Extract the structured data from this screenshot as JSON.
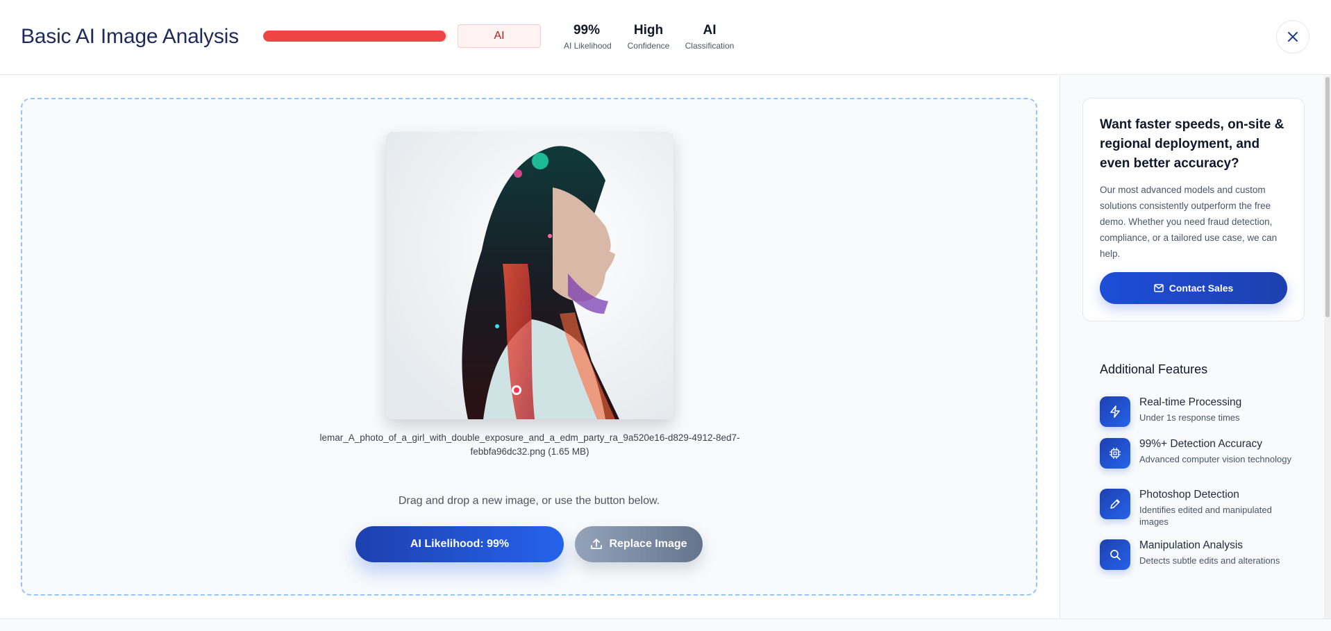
{
  "header": {
    "title": "Basic AI Image Analysis",
    "likelihood_fraction": 0.99,
    "bar_color": "#ef4444",
    "badge_label": "AI",
    "stats": [
      {
        "value": "99%",
        "label": "AI Likelihood"
      },
      {
        "value": "High",
        "label": "Confidence"
      },
      {
        "value": "AI",
        "label": "Classification"
      }
    ]
  },
  "main": {
    "filename": "lemar_A_photo_of_a_girl_with_double_exposure_and_a_edm_party_ra_9a520e16-d829-4912-8ed7-febbfa96dc32.png (1.65 MB)",
    "hint": "Drag and drop a new image, or use the button below.",
    "primary_button": "AI Likelihood: 99%",
    "replace_button": "Replace Image"
  },
  "sidebar": {
    "promo_title": "Want faster speeds, on-site & regional deployment, and even better accuracy?",
    "promo_text": "Our most advanced models and custom solutions consistently outperform the free demo. Whether you need fraud detection, compliance, or a tailored use case, we can help.",
    "contact_button": "Contact Sales",
    "features_title": "Additional Features",
    "features": [
      {
        "title": "Real-time Processing",
        "desc": "Under 1s response times",
        "icon": "lightning-icon"
      },
      {
        "title": "99%+ Detection Accuracy",
        "desc": "Advanced computer vision technology",
        "icon": "chip-icon"
      },
      {
        "title": "Photoshop Detection",
        "desc": "Identifies edited and manipulated images",
        "icon": "pencil-icon"
      },
      {
        "title": "Manipulation Analysis",
        "desc": "Detects subtle edits and alterations",
        "icon": "search-icon"
      }
    ]
  }
}
